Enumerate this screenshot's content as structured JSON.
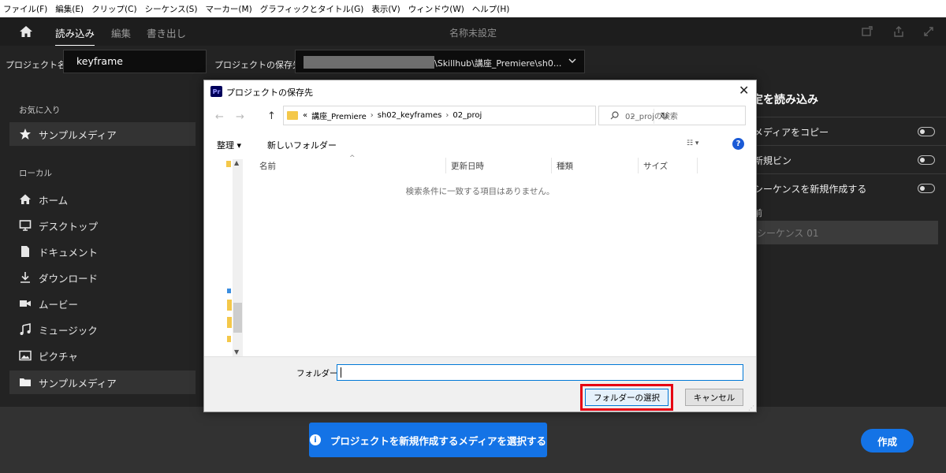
{
  "menubar": [
    "ファイル(F)",
    "編集(E)",
    "クリップ(C)",
    "シーケンス(S)",
    "マーカー(M)",
    "グラフィックとタイトル(G)",
    "表示(V)",
    "ウィンドウ(W)",
    "ヘルプ(H)"
  ],
  "header": {
    "tabs": [
      "読み込み",
      "編集",
      "書き出し"
    ],
    "title": "名称未設定"
  },
  "project": {
    "name_label": "プロジェクト名",
    "name_value": "keyframe",
    "location_label": "プロジェクトの保存先",
    "location_value": "\\Skillhub\\講座_Premiere\\sh0..."
  },
  "sidebar": {
    "favorites_heading": "お気に入り",
    "favorite_item": "サンプルメディア",
    "local_heading": "ローカル",
    "items": [
      "ホーム",
      "デスクトップ",
      "ドキュメント",
      "ダウンロード",
      "ムービー",
      "ミュージック",
      "ピクチャ",
      "サンプルメディア"
    ]
  },
  "right_panel": {
    "title": "定を読み込み",
    "copy_media": "メディアをコピー",
    "new_bin": "新規ビン",
    "new_sequence": "シーケンスを新規作成する",
    "name_label": "前",
    "sequence_name": "シーケンス 01"
  },
  "bottom": {
    "media_button": "プロジェクトを新規作成するメディアを選択する",
    "create_button": "作成"
  },
  "dialog": {
    "logo": "Pr",
    "title": "プロジェクトの保存先",
    "address": {
      "prefix": "«",
      "crumbs": [
        "講座_Premiere",
        "sh02_keyframes",
        "02_proj"
      ]
    },
    "search_placeholder": "02_projの検索",
    "organize": "整理 ▾",
    "new_folder": "新しいフォルダー",
    "columns": [
      "名前",
      "更新日時",
      "種類",
      "サイズ"
    ],
    "empty_message": "検索条件に一致する項目はありません。",
    "folder_label": "フォルダー:",
    "folder_value": "",
    "select_button": "フォルダーの選択",
    "cancel_button": "キャンセル"
  },
  "colors": {
    "accent": "#1473e6",
    "highlight": "#e60012"
  }
}
